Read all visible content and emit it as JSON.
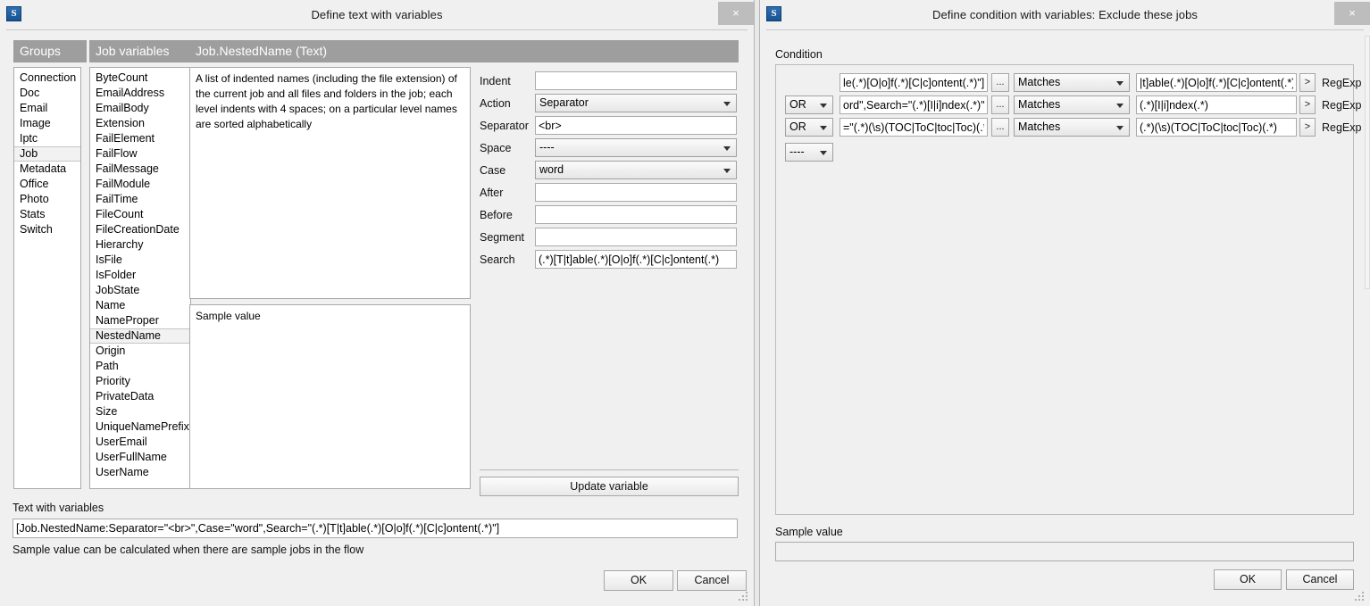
{
  "desktop": {
    "background_color": "#e8e8e8"
  },
  "left_dialog": {
    "app_icon_letter": "S",
    "title": "Define text with variables",
    "close_label": "×",
    "columns": {
      "groups_header": "Groups",
      "variables_header": "Job variables",
      "detail_header": "Job.NestedName (Text)"
    },
    "groups": [
      "Connection",
      "Doc",
      "Email",
      "Image",
      "Iptc",
      "Job",
      "Metadata",
      "Office",
      "Photo",
      "Stats",
      "Switch"
    ],
    "selected_group": "Job",
    "job_variables": [
      "ByteCount",
      "EmailAddress",
      "EmailBody",
      "Extension",
      "FailElement",
      "FailFlow",
      "FailMessage",
      "FailModule",
      "FailTime",
      "FileCount",
      "FileCreationDate",
      "Hierarchy",
      "IsFile",
      "IsFolder",
      "JobState",
      "Name",
      "NameProper",
      "NestedName",
      "Origin",
      "Path",
      "Priority",
      "PrivateData",
      "Size",
      "UniqueNamePrefix",
      "UserEmail",
      "UserFullName",
      "UserName"
    ],
    "selected_variable": "NestedName",
    "description": "A list of indented names (including the file extension) of the current job and all files and folders in the job; each level indents with 4 spaces; on a particular level names are sorted alphabetically",
    "sample_value_label": "Sample value",
    "sample_value": "",
    "fields": [
      {
        "label": "Indent",
        "type": "text",
        "value": ""
      },
      {
        "label": "Action",
        "type": "combo",
        "value": "Separator"
      },
      {
        "label": "Separator",
        "type": "text",
        "value": "<br>"
      },
      {
        "label": "Space",
        "type": "combo",
        "value": "----"
      },
      {
        "label": "Case",
        "type": "combo",
        "value": "word"
      },
      {
        "label": "After",
        "type": "text",
        "value": ""
      },
      {
        "label": "Before",
        "type": "text",
        "value": ""
      },
      {
        "label": "Segment",
        "type": "text",
        "value": ""
      },
      {
        "label": "Search",
        "type": "text",
        "value": "(.*)[T|t]able(.*)[O|o]f(.*)[C|c]ontent(.*)"
      }
    ],
    "update_button": "Update variable",
    "text_with_variables_label": "Text with variables",
    "text_with_variables_value": "[Job.NestedName:Separator=\"<br>\",Case=\"word\",Search=\"(.*)[T|t]able(.*)[O|o]f(.*)[C|c]ontent(.*)\"]",
    "hint": "Sample value can be calculated when there are sample jobs in the flow",
    "ok_label": "OK",
    "cancel_label": "Cancel"
  },
  "right_dialog": {
    "app_icon_letter": "S",
    "title": "Define condition with variables: Exclude these jobs",
    "close_label": "×",
    "condition_label": "Condition",
    "rows": [
      {
        "logic": "",
        "expression": "le(.*)[O|o]f(.*)[C|c]ontent(.*)\"]",
        "browse_label": "...",
        "operator": "Matches",
        "value": "|t]able(.*)[O|o]f(.*)[C|c]ontent(.*)",
        "chevron_label": ">",
        "type_label": "RegExp"
      },
      {
        "logic": "OR",
        "expression": "ord\",Search=\"(.*)[I|i]ndex(.*)\"]",
        "browse_label": "...",
        "operator": "Matches",
        "value": "(.*)[I|i]ndex(.*)",
        "chevron_label": ">",
        "type_label": "RegExp"
      },
      {
        "logic": "OR",
        "expression": "=\"(.*)(\\s)(TOC|ToC|toc|Toc)(.*)\"]",
        "browse_label": "...",
        "operator": "Matches",
        "value": "(.*)(\\s)(TOC|ToC|toc|Toc)(.*)",
        "chevron_label": ">",
        "type_label": "RegExp"
      }
    ],
    "trailing_logic": "----",
    "sample_value_label": "Sample value",
    "sample_value": "",
    "ok_label": "OK",
    "cancel_label": "Cancel"
  }
}
